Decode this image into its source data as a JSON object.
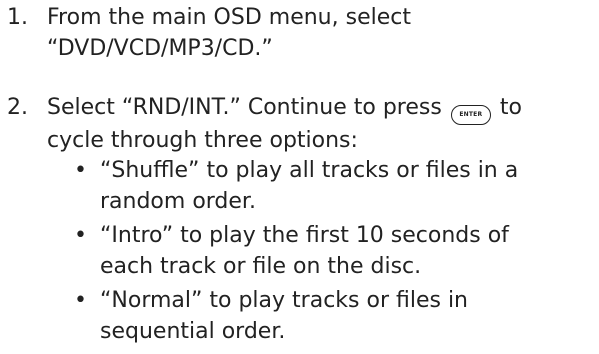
{
  "steps": [
    {
      "number": "1.",
      "lines": [
        "From the main OSD menu, select",
        "“DVD/VCD/MP3/CD.”"
      ]
    },
    {
      "number": "2.",
      "line1_before": "Select “RND/INT.” Continue to press",
      "line1_after": "to",
      "line2": "cycle through three options:",
      "button_label": "ENTER",
      "button_icon": "enter-button-icon",
      "bullets": [
        {
          "lines": [
            "“Shuffle” to play all tracks or files in a",
            "random order."
          ]
        },
        {
          "lines": [
            "“Intro” to play the first 10 seconds of",
            "each track or file on the disc."
          ]
        },
        {
          "lines": [
            "“Normal” to play tracks or files in",
            "sequential order."
          ]
        }
      ]
    }
  ],
  "bullet_char": "•"
}
